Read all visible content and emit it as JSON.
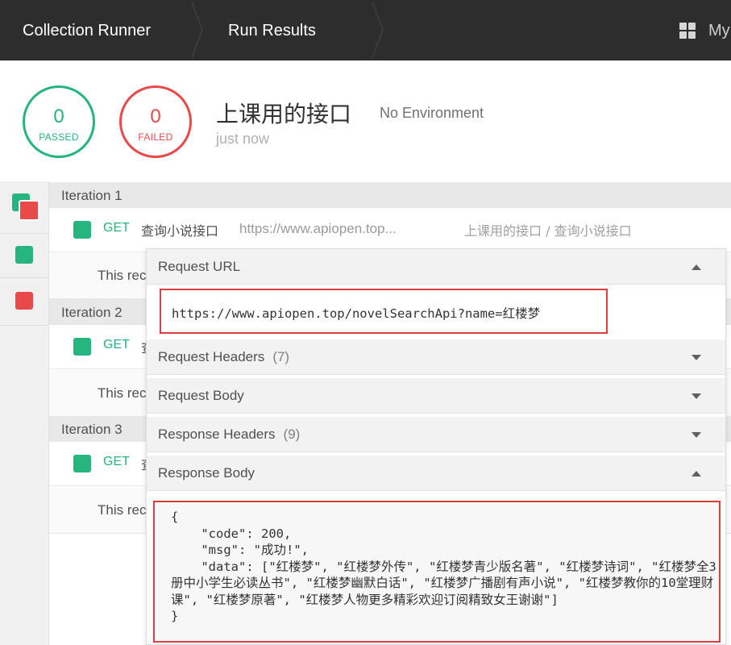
{
  "header": {
    "breadcrumb": [
      "Collection Runner",
      "Run Results"
    ],
    "workspace_label": "My"
  },
  "summary": {
    "passed_count": "0",
    "passed_label": "PASSED",
    "failed_count": "0",
    "failed_label": "FAILED",
    "collection_name": "上课用的接口",
    "environment": "No Environment",
    "time": "just now"
  },
  "iterations": [
    {
      "label": "Iteration 1",
      "request": {
        "method": "GET",
        "name": "查询小说接口",
        "url": "https://www.apiopen.top...",
        "path": "上课用的接口 / 查询小说接口"
      },
      "note": "This rec"
    },
    {
      "label": "Iteration 2",
      "request": {
        "method": "GET",
        "name": "查"
      },
      "note": "This rec"
    },
    {
      "label": "Iteration 3",
      "request": {
        "method": "GET",
        "name": "查"
      },
      "note": "This rec"
    }
  ],
  "details": {
    "request_url_title": "Request URL",
    "request_url": "https://www.apiopen.top/novelSearchApi?name=红楼梦",
    "request_headers_title": "Request Headers",
    "request_headers_count": "(7)",
    "request_body_title": "Request Body",
    "response_headers_title": "Response Headers",
    "response_headers_count": "(9)",
    "response_body_title": "Response Body",
    "response_body": "{\n    \"code\": 200,\n    \"msg\": \"成功!\",\n    \"data\": [\"红楼梦\", \"红楼梦外传\", \"红楼梦青少版名著\", \"红楼梦诗词\", \"红楼梦全3册中小学生必读丛书\", \"红楼梦幽默白话\", \"红楼梦广播剧有声小说\", \"红楼梦教你的10堂理财课\", \"红楼梦原著\", \"红楼梦人物更多精彩欢迎订阅精致女王谢谢\"]\n}"
  },
  "colors": {
    "topbar": "#2d2d2d",
    "pass": "#26b47f",
    "fail": "#e84a4a",
    "highlight": "#e03c3c"
  },
  "icons": {
    "workspace": "grid-icon",
    "expand": "caret-down-icon",
    "collapse": "caret-up-icon"
  }
}
